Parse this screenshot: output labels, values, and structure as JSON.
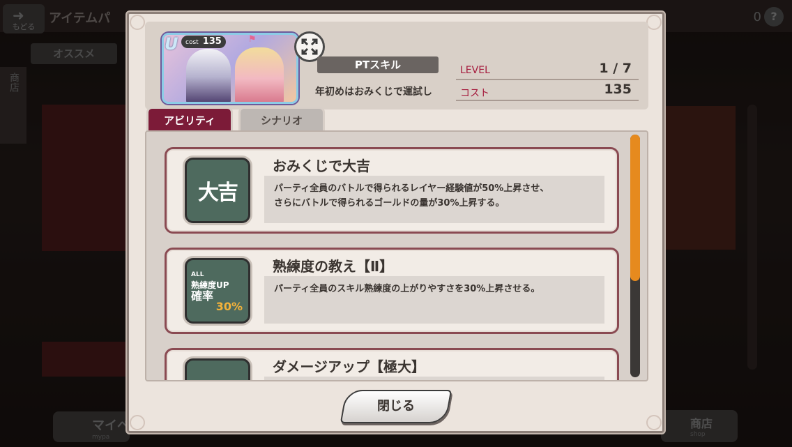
{
  "background": {
    "back_label": "もどる",
    "title": "アイテムパ",
    "coins": "0",
    "help": "?",
    "tab_recommended": "オススメ",
    "side_tab": "商店",
    "mypage_label": "マイペ",
    "mypage_sub": "mypa",
    "shop_label": "商店",
    "shop_sub": "shop"
  },
  "modal": {
    "card": {
      "rarity_badge": "U",
      "cost_label": "cost",
      "cost_value": "135"
    },
    "pt_skill_label": "PTスキル",
    "pt_skill_name": "年初めはおみくじで運試し",
    "stats": {
      "level_label": "LEVEL",
      "level_value": "1 / 7",
      "cost_label": "コスト",
      "cost_value": "135"
    },
    "tabs": {
      "ability": "アビリティ",
      "scenario": "シナリオ"
    },
    "abilities": [
      {
        "title": "おみくじで大吉",
        "icon_text": "大吉",
        "desc_line1": "パーティ全員のバトルで得られるレイヤー経験値が50%上昇させ、",
        "desc_line2": "さらにバトルで得られるゴールドの量が30%上昇する。"
      },
      {
        "title": "熟練度の教え【Ⅱ】",
        "icon_top": "ALL",
        "icon_line1": "熟練度UP",
        "icon_line2": "確率",
        "icon_line3": "30%",
        "desc_line1": "パーティ全員のスキル熟練度の上がりやすさを30%上昇させる。",
        "desc_line2": ""
      },
      {
        "title": "ダメージアップ【極大】",
        "desc_line1": "",
        "desc_line2": ""
      }
    ],
    "close_label": "閉じる"
  },
  "colors": {
    "accent": "#7c1b38",
    "level_label": "#a51a3c",
    "scroll_thumb": "#e68a1e",
    "icon_bg": "#4e6a5e"
  }
}
